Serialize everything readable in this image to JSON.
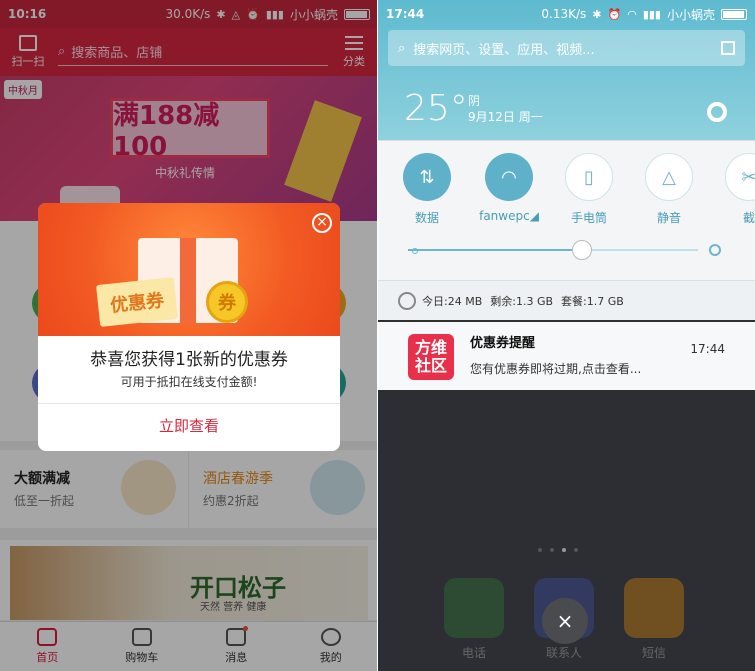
{
  "left": {
    "status": {
      "time": "10:16",
      "speed": "30.0K/s",
      "carrier": "小小蜗壳"
    },
    "nav": {
      "scan": "扫一扫",
      "search_placeholder": "搜索商品、店铺",
      "category": "分类"
    },
    "banner": {
      "festival": "中秋月",
      "headline": "满188减100",
      "sub": "中秋礼传情"
    },
    "cards": [
      {
        "title": "大额满减",
        "sub": "低至一折起"
      },
      {
        "title": "酒店春游季",
        "sub": "约惠2折起"
      }
    ],
    "snack": {
      "title": "开口松子",
      "sub": "天然 营养 健康"
    },
    "tabs": [
      {
        "label": "首页"
      },
      {
        "label": "购物车"
      },
      {
        "label": "消息"
      },
      {
        "label": "我的"
      }
    ],
    "modal": {
      "coupon": "优惠券",
      "coin": "券",
      "heading": "恭喜您获得1张新的优惠券",
      "desc": "可用于抵扣在线支付金额!",
      "button": "立即查看"
    }
  },
  "right": {
    "status": {
      "time": "17:44",
      "speed": "0.13K/s",
      "carrier": "小小蜗壳"
    },
    "search_placeholder": "搜索网页、设置、应用、视频...",
    "weather": {
      "temp": "25°",
      "cond": "阴",
      "date": "9月12日 周一"
    },
    "toggles": [
      {
        "label": "数据",
        "icon": "↕",
        "on": true
      },
      {
        "label": "fanwepc◢",
        "icon": "wifi",
        "on": true
      },
      {
        "label": "手电筒",
        "icon": "flashlight",
        "on": false
      },
      {
        "label": "静音",
        "icon": "bell",
        "on": false
      },
      {
        "label": "截",
        "icon": "screenshot",
        "on": false
      }
    ],
    "brightness_level": 0.6,
    "storage": {
      "today": "今日:24 MB",
      "remain": "剩余:1.3 GB",
      "plan": "套餐:1.7 GB"
    },
    "notification": {
      "app_icon_line1": "方维",
      "app_icon_line2": "社区",
      "title": "优惠券提醒",
      "body": "您有优惠券即将过期,点击查看...",
      "time": "17:44"
    },
    "dock": [
      {
        "label": "电话"
      },
      {
        "label": "联系人"
      },
      {
        "label": "短信"
      }
    ],
    "close": "×"
  }
}
